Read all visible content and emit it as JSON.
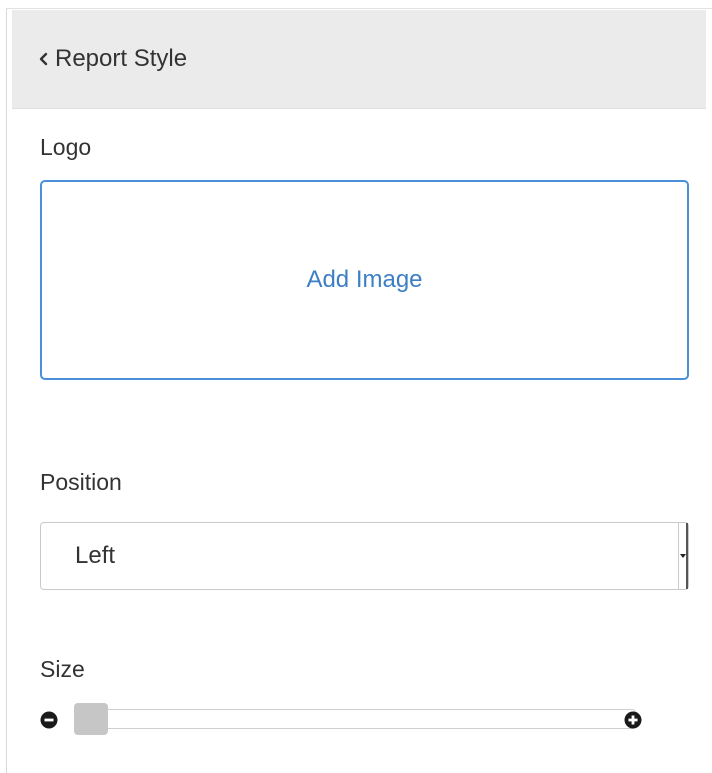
{
  "header": {
    "back_icon": "chevron-left-icon",
    "title": "Report Style"
  },
  "logo": {
    "label": "Logo",
    "add_image_label": "Add Image"
  },
  "position": {
    "label": "Position",
    "selected": "Left"
  },
  "size": {
    "label": "Size",
    "decrease_icon": "minus-circle-icon",
    "increase_icon": "plus-circle-icon",
    "level_fraction": 0
  },
  "colors": {
    "accent": "#4a90d9",
    "header_bg": "#ebebeb",
    "thumb": "#c6c6c6"
  }
}
